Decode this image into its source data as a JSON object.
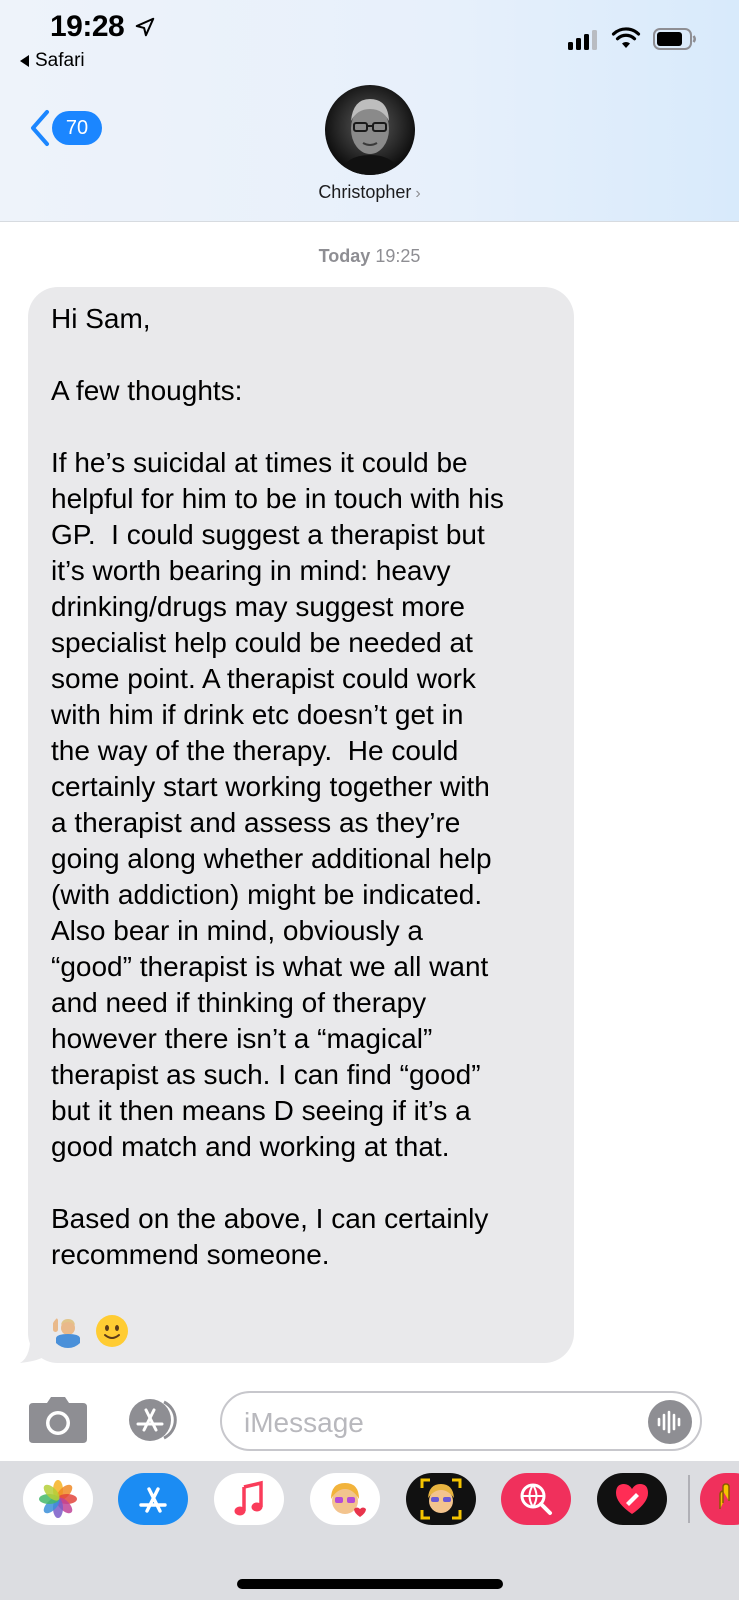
{
  "status_bar": {
    "time": "19:28",
    "back_app": "Safari"
  },
  "header": {
    "unread_count": "70",
    "contact_name": "Christopher",
    "contact_chevron": "›"
  },
  "conversation": {
    "timestamp_day": "Today",
    "timestamp_time": "19:25",
    "message": {
      "paragraphs": [
        "Hi Sam,",
        "A few thoughts:",
        "If he’s suicidal at times it could be\nhelpful for him to be in touch with his\nGP.  I could suggest a therapist but\nit’s worth bearing in mind: heavy\ndrinking/drugs may suggest more\nspecialist help could be needed at\nsome point. A therapist could work\nwith him if drink etc doesn’t get in\nthe way of the therapy.  He could\ncertainly start working together with\na therapist and assess as they’re\ngoing along whether additional help\n(with addiction) might be indicated.\nAlso bear in mind, obviously a\n“good” therapist is what we all want\nand need if thinking of therapy\nhowever there isn’t a “magical”\ntherapist as such. I can find “good”\nbut it then means D seeing if it’s a\ngood match and working at that.",
        "Based on the above, I can certainly\nrecommend someone."
      ],
      "emojis": [
        "person-raising-hand-emoji",
        "slightly-smiling-face-emoji"
      ]
    }
  },
  "composer": {
    "placeholder": "iMessage"
  },
  "app_drawer": {
    "apps": [
      "photos-app",
      "app-store-app",
      "music-app",
      "memoji-stickers-app",
      "animoji-app",
      "images-search-app",
      "digital-touch-app",
      "more-app"
    ]
  },
  "colors": {
    "accent": "#1b86ff",
    "bubble_received": "#e9e9eb",
    "timestamp": "#8e8e93"
  }
}
